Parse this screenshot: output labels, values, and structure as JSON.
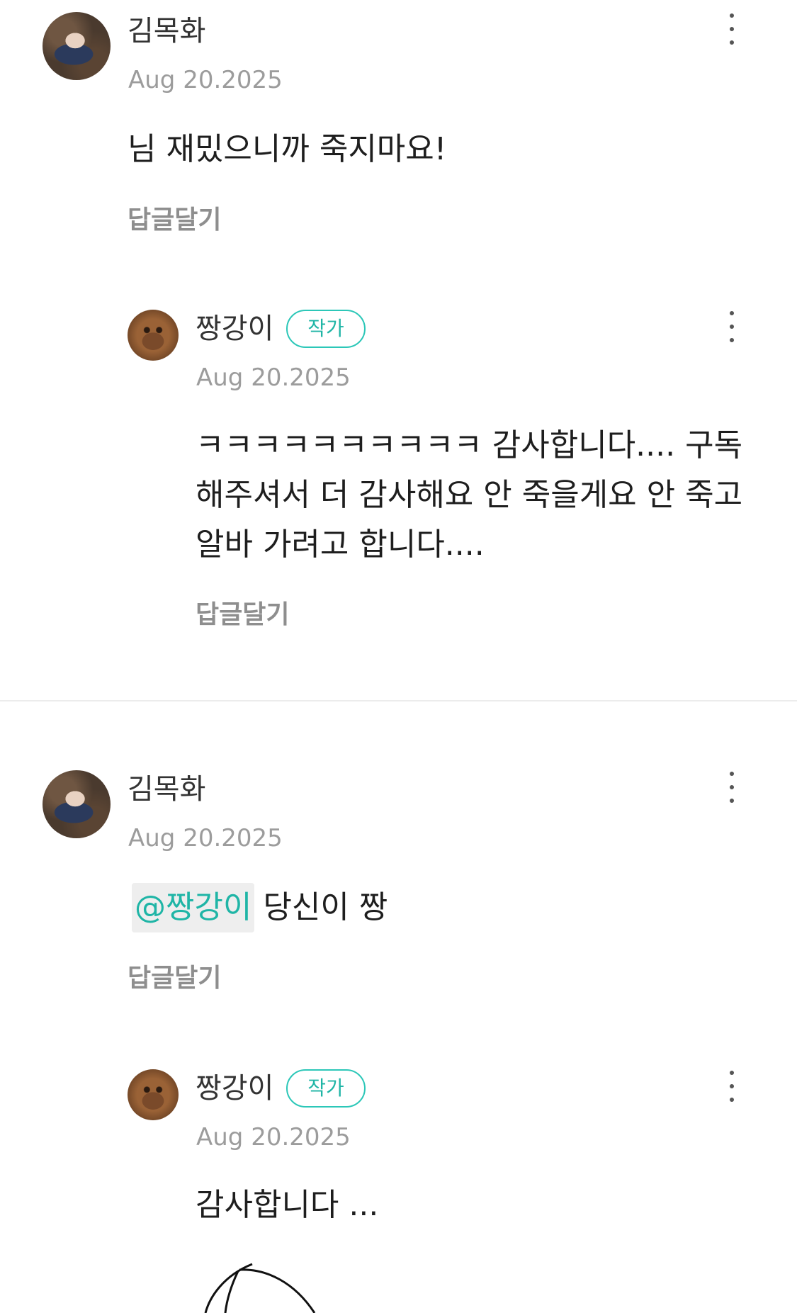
{
  "thread1": {
    "comment": {
      "author": "김목화",
      "date": "Aug 20.2025",
      "text": "님 재밌으니까 죽지마요!",
      "reply_label": "답글달기",
      "avatar_icon": "avatar-photo-icon"
    },
    "reply": {
      "author": "짱강이",
      "badge": "작가",
      "date": "Aug 20.2025",
      "text": "ㅋㅋㅋㅋㅋㅋㅋㅋㅋㅋ 감사합니다.... 구독해주셔서 더 감사해요 안 죽을게요 안 죽고 알바 가려고 합니다....",
      "reply_label": "답글달기",
      "avatar_icon": "avatar-dog-icon"
    }
  },
  "thread2": {
    "comment": {
      "author": "김목화",
      "date": "Aug 20.2025",
      "mention": "@짱강이",
      "text": "당신이 짱",
      "reply_label": "답글달기",
      "avatar_icon": "avatar-photo-icon"
    },
    "reply": {
      "author": "짱강이",
      "badge": "작가",
      "date": "Aug 20.2025",
      "text": "감사합니다 ...",
      "avatar_icon": "avatar-dog-icon",
      "drawing": "sketch-image"
    }
  },
  "icons": {
    "more": "more-vertical-icon"
  },
  "colors": {
    "accent": "#1fb5a6",
    "badge_border": "#2cc7b8",
    "date": "#9c9c9c",
    "reply_link": "#8e8e8e",
    "divider": "#ececec"
  }
}
